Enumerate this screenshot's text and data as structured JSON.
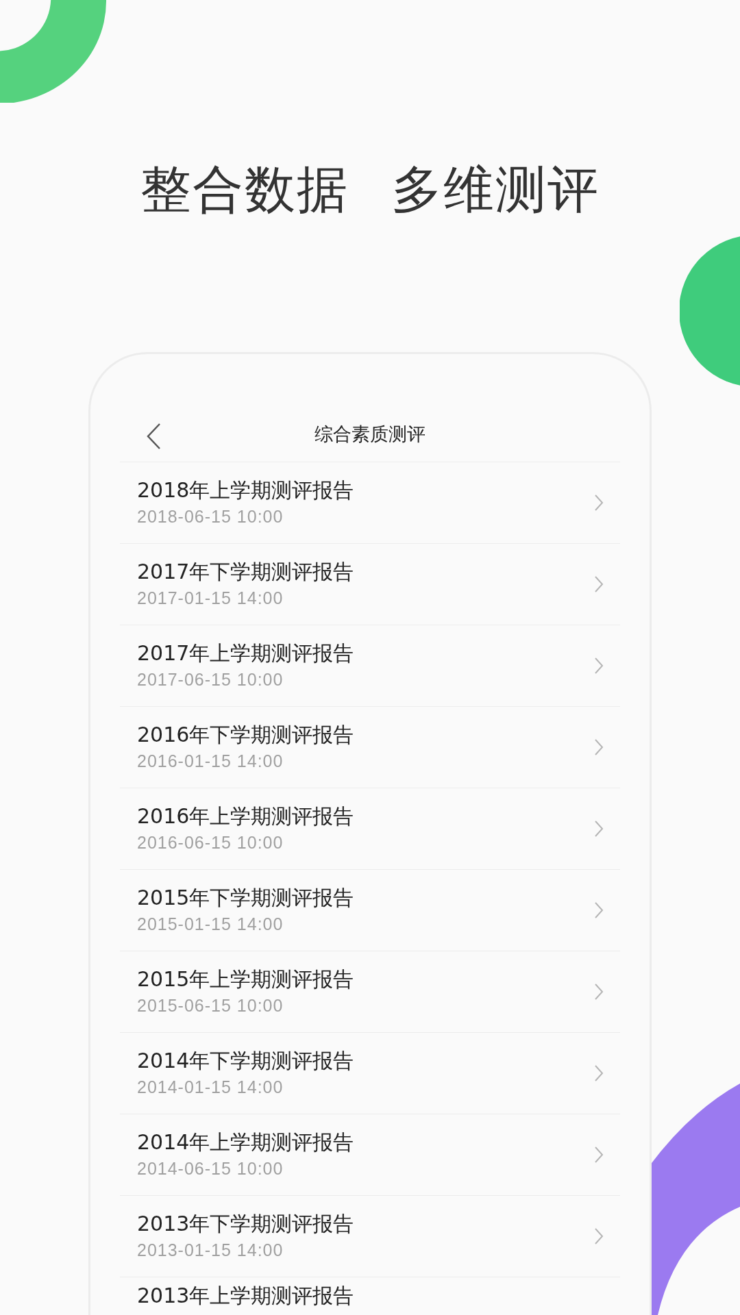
{
  "headline": [
    "整合数据",
    "多维测评"
  ],
  "screen": {
    "title": "综合素质测评",
    "reports": [
      {
        "title": "2018年上学期测评报告",
        "time": "2018-06-15 10:00"
      },
      {
        "title": "2017年下学期测评报告",
        "time": "2017-01-15 14:00"
      },
      {
        "title": "2017年上学期测评报告",
        "time": "2017-06-15 10:00"
      },
      {
        "title": "2016年下学期测评报告",
        "time": "2016-01-15 14:00"
      },
      {
        "title": "2016年上学期测评报告",
        "time": "2016-06-15 10:00"
      },
      {
        "title": "2015年下学期测评报告",
        "time": "2015-01-15 14:00"
      },
      {
        "title": "2015年上学期测评报告",
        "time": "2015-06-15 10:00"
      },
      {
        "title": "2014年下学期测评报告",
        "time": "2014-01-15 14:00"
      },
      {
        "title": "2014年上学期测评报告",
        "time": "2014-06-15 10:00"
      },
      {
        "title": "2013年下学期测评报告",
        "time": "2013-01-15 14:00"
      },
      {
        "title": "2013年上学期测评报告"
      }
    ]
  }
}
